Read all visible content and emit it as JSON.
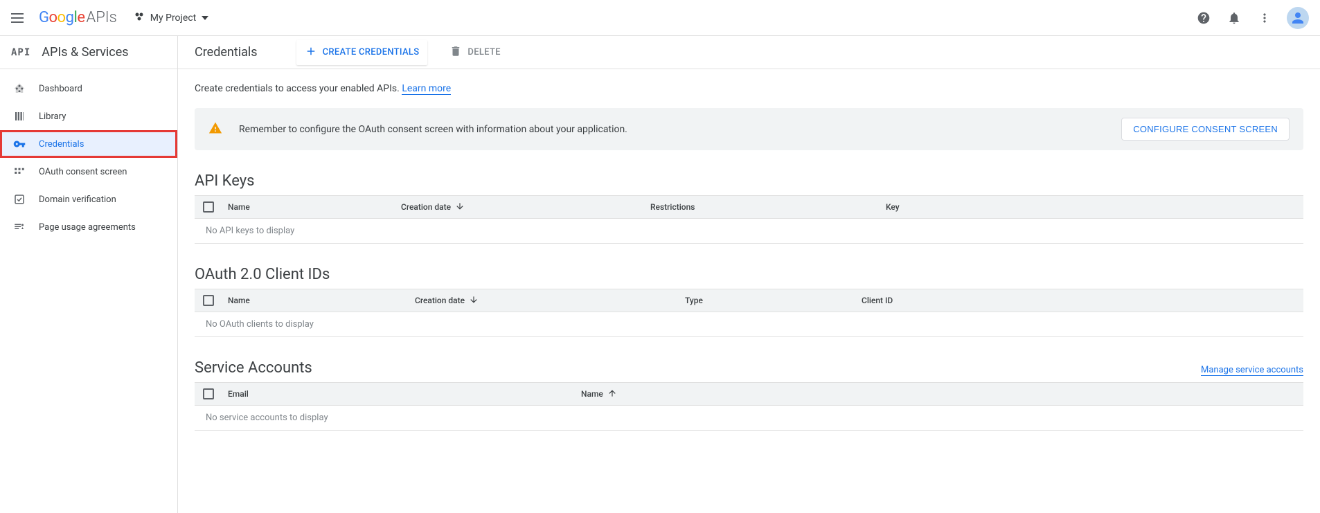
{
  "topbar": {
    "logo_apis": "APIs",
    "project_name": "My Project"
  },
  "sidebar": {
    "header": "APIs & Services",
    "items": [
      {
        "label": "Dashboard"
      },
      {
        "label": "Library"
      },
      {
        "label": "Credentials"
      },
      {
        "label": "OAuth consent screen"
      },
      {
        "label": "Domain verification"
      },
      {
        "label": "Page usage agreements"
      }
    ]
  },
  "header": {
    "title": "Credentials",
    "create": "CREATE CREDENTIALS",
    "delete": "DELETE"
  },
  "intro": {
    "text": "Create credentials to access your enabled APIs. ",
    "link": "Learn more"
  },
  "alert": {
    "text": "Remember to configure the OAuth consent screen with information about your application.",
    "button": "CONFIGURE CONSENT SCREEN"
  },
  "sections": {
    "api_keys": {
      "title": "API Keys",
      "cols": {
        "name": "Name",
        "date": "Creation date",
        "restrictions": "Restrictions",
        "key": "Key"
      },
      "empty": "No API keys to display"
    },
    "oauth": {
      "title": "OAuth 2.0 Client IDs",
      "cols": {
        "name": "Name",
        "date": "Creation date",
        "type": "Type",
        "client": "Client ID"
      },
      "empty": "No OAuth clients to display"
    },
    "service": {
      "title": "Service Accounts",
      "link": "Manage service accounts",
      "cols": {
        "email": "Email",
        "name": "Name"
      },
      "empty": "No service accounts to display"
    }
  }
}
